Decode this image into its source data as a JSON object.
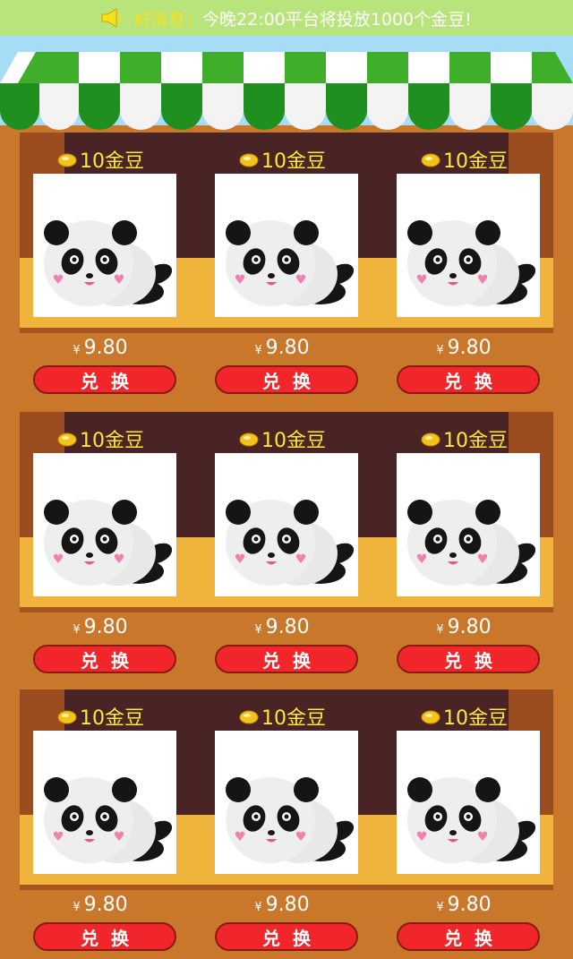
{
  "notice": {
    "icon": "speaker-icon",
    "label": "好消息：",
    "text": "今晚22:00平台将投放1000个金豆!"
  },
  "colors": {
    "notice_bg": "#b9e47c",
    "awning_green": "#3fae2a",
    "wall": "#c8772b",
    "button": "#f0262a",
    "coin_text": "#ffe838"
  },
  "products": [
    {
      "coins": "10金豆",
      "currency": "¥",
      "price": "9.80",
      "button": "兑换",
      "image": "panda-plush"
    },
    {
      "coins": "10金豆",
      "currency": "¥",
      "price": "9.80",
      "button": "兑换",
      "image": "panda-plush"
    },
    {
      "coins": "10金豆",
      "currency": "¥",
      "price": "9.80",
      "button": "兑换",
      "image": "panda-plush"
    },
    {
      "coins": "10金豆",
      "currency": "¥",
      "price": "9.80",
      "button": "兑换",
      "image": "panda-plush"
    },
    {
      "coins": "10金豆",
      "currency": "¥",
      "price": "9.80",
      "button": "兑换",
      "image": "panda-plush"
    },
    {
      "coins": "10金豆",
      "currency": "¥",
      "price": "9.80",
      "button": "兑换",
      "image": "panda-plush"
    },
    {
      "coins": "10金豆",
      "currency": "¥",
      "price": "9.80",
      "button": "兑换",
      "image": "panda-plush"
    },
    {
      "coins": "10金豆",
      "currency": "¥",
      "price": "9.80",
      "button": "兑换",
      "image": "panda-plush"
    },
    {
      "coins": "10金豆",
      "currency": "¥",
      "price": "9.80",
      "button": "兑换",
      "image": "panda-plush"
    }
  ]
}
